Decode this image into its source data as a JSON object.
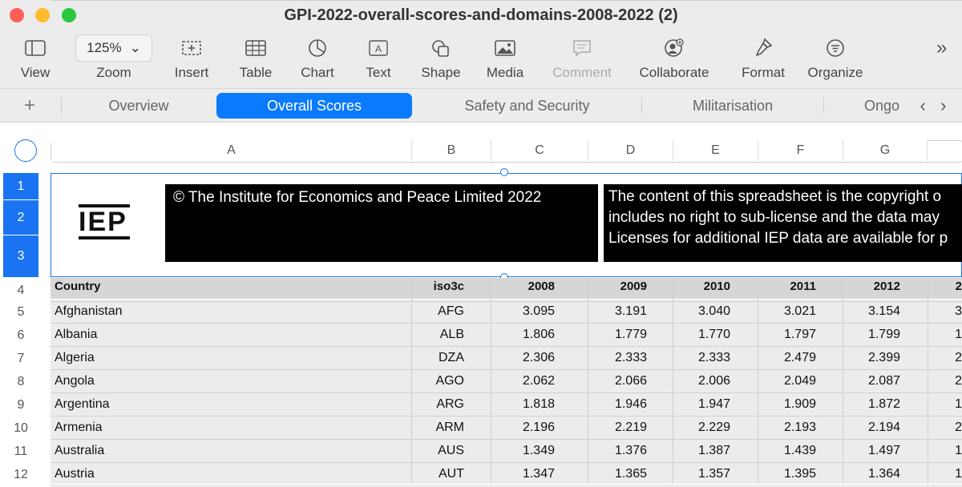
{
  "window": {
    "title": "GPI-2022-overall-scores-and-domains-2008-2022 (2)"
  },
  "toolbar": {
    "view": "View",
    "zoom_value": "125%",
    "zoom": "Zoom",
    "insert": "Insert",
    "table": "Table",
    "chart": "Chart",
    "text": "Text",
    "shape": "Shape",
    "media": "Media",
    "comment": "Comment",
    "collaborate": "Collaborate",
    "format": "Format",
    "organize": "Organize"
  },
  "sheets": {
    "add": "+",
    "tabs": [
      "Overview",
      "Overall Scores",
      "Safety and Security",
      "Militarisation",
      "Ongo"
    ],
    "active": "Overall Scores"
  },
  "columns": [
    "A",
    "B",
    "C",
    "D",
    "E",
    "F",
    "G"
  ],
  "rows": [
    "1",
    "2",
    "3",
    "4",
    "5",
    "6",
    "7",
    "8",
    "9",
    "10",
    "11",
    "12"
  ],
  "header_block": {
    "logo": "IEP",
    "copyright": "© The Institute for Economics and Peace Limited 2022",
    "notice": [
      "The content of this spreadsheet is the copyright o",
      "includes no right to sub-license and the data may",
      "Licenses for additional IEP data are available for p"
    ]
  },
  "table": {
    "headers": [
      "Country",
      "iso3c",
      "2008",
      "2009",
      "2010",
      "2011",
      "2012",
      "2"
    ],
    "data": [
      [
        "Afghanistan",
        "AFG",
        "3.095",
        "3.191",
        "3.040",
        "3.021",
        "3.154",
        "3"
      ],
      [
        "Albania",
        "ALB",
        "1.806",
        "1.779",
        "1.770",
        "1.797",
        "1.799",
        "1"
      ],
      [
        "Algeria",
        "DZA",
        "2.306",
        "2.333",
        "2.333",
        "2.479",
        "2.399",
        "2"
      ],
      [
        "Angola",
        "AGO",
        "2.062",
        "2.066",
        "2.006",
        "2.049",
        "2.087",
        "2"
      ],
      [
        "Argentina",
        "ARG",
        "1.818",
        "1.946",
        "1.947",
        "1.909",
        "1.872",
        "1"
      ],
      [
        "Armenia",
        "ARM",
        "2.196",
        "2.219",
        "2.229",
        "2.193",
        "2.194",
        "2"
      ],
      [
        "Australia",
        "AUS",
        "1.349",
        "1.376",
        "1.387",
        "1.439",
        "1.497",
        "1"
      ],
      [
        "Austria",
        "AUT",
        "1.347",
        "1.365",
        "1.357",
        "1.395",
        "1.364",
        "1"
      ]
    ]
  }
}
